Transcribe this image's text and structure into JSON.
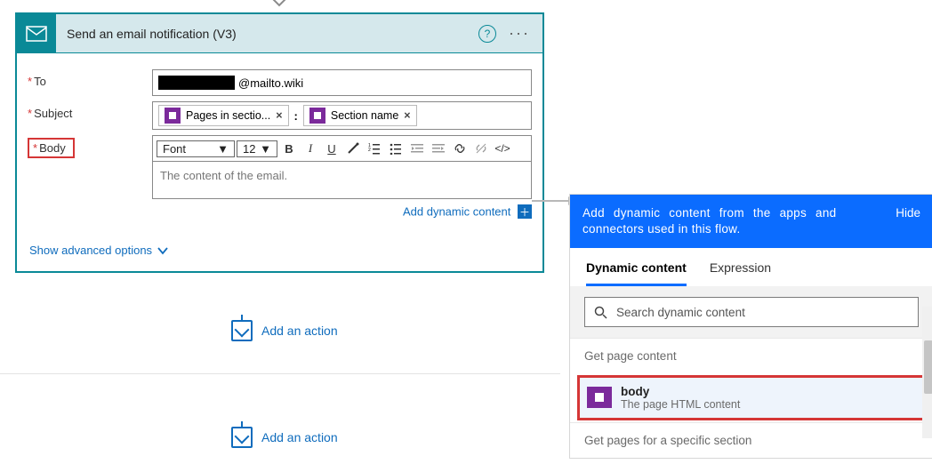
{
  "card": {
    "title": "Send an email notification (V3)",
    "help": "?",
    "menu": "···",
    "fields": {
      "to_label": "To",
      "subject_label": "Subject",
      "body_label": "Body",
      "to_value_suffix": "@mailto.wiki",
      "body_placeholder": "The content of the email."
    },
    "chips": {
      "pages_in_section": "Pages in sectio...",
      "separator": ":",
      "section_name": "Section name"
    },
    "toolbar": {
      "font": "Font",
      "size": "12"
    },
    "add_dynamic": "Add dynamic content",
    "advanced": "Show advanced options"
  },
  "actions": {
    "add_action": "Add an action"
  },
  "right": {
    "header_words": [
      "Add",
      "dynamic",
      "content",
      "from",
      "the",
      "apps",
      "and"
    ],
    "header_line2": "connectors used in this flow.",
    "hide": "Hide",
    "tabs": {
      "dynamic": "Dynamic content",
      "expression": "Expression"
    },
    "search_placeholder": "Search dynamic content",
    "sections": {
      "s1": "Get page content",
      "s2": "Get pages for a specific section"
    },
    "item": {
      "name": "body",
      "desc": "The page HTML content"
    }
  }
}
